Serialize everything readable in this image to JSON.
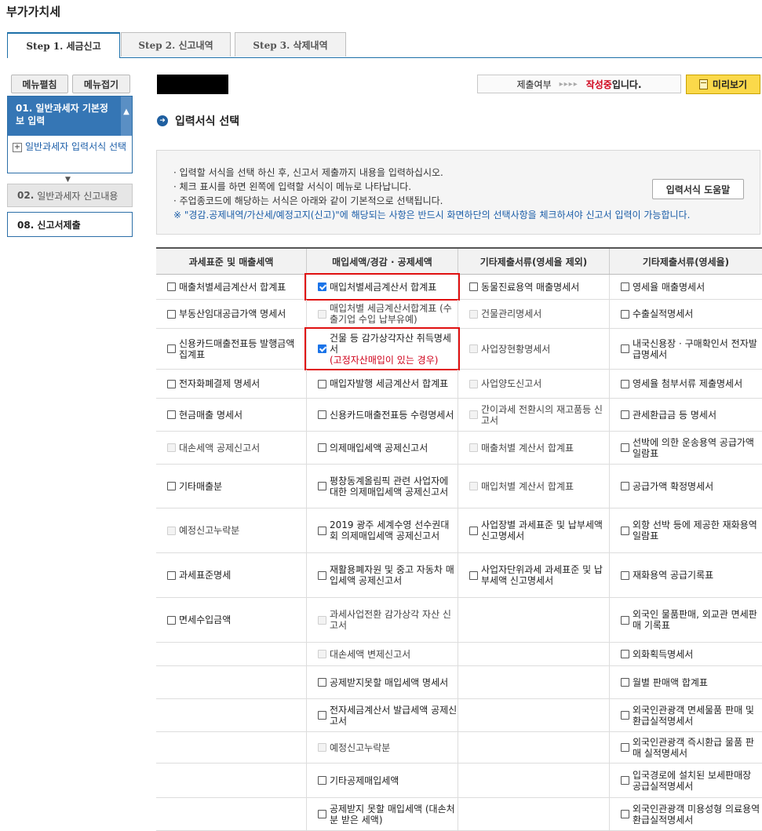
{
  "page_title": "부가가치세",
  "tabs": [
    "Step 1. 세금신고",
    "Step 2. 신고내역",
    "Step 3. 삭제내역"
  ],
  "sidebar": {
    "menu_open": "메뉴펼침",
    "menu_close": "메뉴접기",
    "section1_title": "01. 일반과세자 기본정보 입력",
    "section1_sub": "일반과세자 입력서식 선택",
    "section2_num": "02.",
    "section2_label": "일반과세자 신고내용",
    "section3_title": "08. 신고서제출"
  },
  "status": {
    "label": "제출여부",
    "arrows": "▸▸▸▸",
    "state": "작성중",
    "suffix": "입니다."
  },
  "preview_button": "미리보기",
  "section_title": "입력서식 선택",
  "info": {
    "line1": "입력할 서식을 선택 하신 후, 신고서 제출까지 내용을 입력하십시오.",
    "line2": "체크 표시를 하면 왼쪽에 입력할 서식이 메뉴로 나타납니다.",
    "line3": "주업종코드에 해당하는 서식은 아래와 같이 기본적으로 선택됩니다.",
    "line4": "※ \"경감.공제내역/가산세/예정고지(신고)\"에 해당되는 사항은 반드시 화면하단의 선택사항을 체크하셔야 신고서 입력이 가능합니다.",
    "help_button": "입력서식 도움말"
  },
  "table": {
    "headers": [
      "과세표준 및 매출세액",
      "매입세액/경감 · 공제세액",
      "기타제출서류(영세율 제외)",
      "기타제출서류(영세율)"
    ],
    "rows": [
      [
        "매출처별세금계산서 합계표",
        "매입처별세금계산서 합계표",
        "동물진료용역 매출명세서",
        "영세율 매출명세서"
      ],
      [
        "부동산임대공급가액 명세서",
        "매입처별 세금계산서합계표 (수출기업 수입 납부유예)",
        "건물관리명세서",
        "수출실적명세서"
      ],
      [
        "신용카드매출전표등 발행금액 집계표",
        "건물 등 감가상각자산 취득명세서",
        "사업장현황명세서",
        "내국신용장 · 구매확인서 전자발급명세서"
      ],
      [
        "전자화폐결제 명세서",
        "매입자발행 세금계산서 합계표",
        "사업양도신고서",
        "영세율 첨부서류 제출명세서"
      ],
      [
        "현금매출 명세서",
        "신용카드매출전표등 수령명세서",
        "간이과세 전환시의 재고품등 신고서",
        "관세환급금 등 명세서"
      ],
      [
        "대손세액 공제신고서",
        "의제매입세액 공제신고서",
        "매출처별 계산서 합계표",
        "선박에 의한 운송용역 공급가액 일람표"
      ],
      [
        "기타매출분",
        "평창동계올림픽 관련 사업자에 대한 의제매입세액 공제신고서",
        "매입처별 계산서 합계표",
        "공급가액 확정명세서"
      ],
      [
        "예정신고누락분",
        "2019 광주 세계수영 선수권대회 의제매입세액 공제신고서",
        "사업장별 과세표준 및 납부세액 신고명세서",
        "외항 선박 등에 제공한 재화용역 일람표"
      ],
      [
        "과세표준명세",
        "재활용폐자원 및 중고 자동차 매입세액 공제신고서",
        "사업자단위과세 과세표준 및 납부세액 신고명세서",
        "재화용역 공급기록표"
      ],
      [
        "면세수입금액",
        "과세사업전환 감가상각 자산 신고서",
        "",
        "외국인 물품판매, 외교관 면세판매 기록표"
      ],
      [
        "",
        "대손세액 변제신고서",
        "",
        "외화획득명세서"
      ],
      [
        "",
        "공제받지못할 매입세액 명세서",
        "",
        "월별 판매액 합계표"
      ],
      [
        "",
        "전자세금계산서 발급세액 공제신고서",
        "",
        "외국인관광객 면세물품 판매 및 환급실적명세서"
      ],
      [
        "",
        "예정신고누락분",
        "",
        "외국인관광객 즉시환급 물품 판매 실적명세서"
      ],
      [
        "",
        "기타공제매입세액",
        "",
        "입국경로에 설치된 보세판매장 공급실적명세서"
      ],
      [
        "",
        "공제받지 못할 매입세액 (대손처분 받은 세액)",
        "",
        "외국인관광객 미용성형 의료용역 환급실적명세서"
      ]
    ],
    "note_r2c1": "(고정자산매입이 있는 경우)"
  }
}
